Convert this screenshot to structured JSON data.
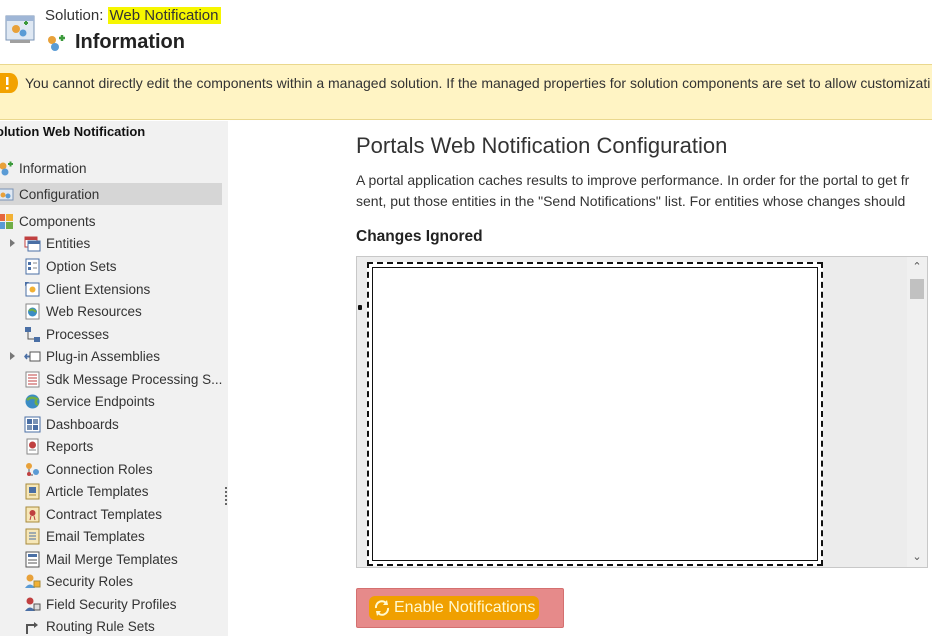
{
  "header": {
    "solution_prefix": "Solution: ",
    "solution_name": "Web Notification",
    "page_title": "Information"
  },
  "warning": {
    "text": "You cannot directly edit the components within a managed solution. If the managed properties for solution components are set to allow customizati"
  },
  "sidebar": {
    "title": "olution Web Notification",
    "items": [
      {
        "label": "Information"
      },
      {
        "label": "Configuration"
      },
      {
        "label": "Components"
      },
      {
        "label": "Entities"
      },
      {
        "label": "Option Sets"
      },
      {
        "label": "Client Extensions"
      },
      {
        "label": "Web Resources"
      },
      {
        "label": "Processes"
      },
      {
        "label": "Plug-in Assemblies"
      },
      {
        "label": "Sdk Message Processing S..."
      },
      {
        "label": "Service Endpoints"
      },
      {
        "label": "Dashboards"
      },
      {
        "label": "Reports"
      },
      {
        "label": "Connection Roles"
      },
      {
        "label": "Article Templates"
      },
      {
        "label": "Contract Templates"
      },
      {
        "label": "Email Templates"
      },
      {
        "label": "Mail Merge Templates"
      },
      {
        "label": "Security Roles"
      },
      {
        "label": "Field Security Profiles"
      },
      {
        "label": "Routing Rule Sets"
      }
    ]
  },
  "main": {
    "title": "Portals Web Notification Configuration",
    "description_line1": "A portal application caches results to improve performance. In order for the portal to get fr",
    "description_line2": "sent, put those entities in the \"Send Notifications\" list. For entities whose changes should",
    "changes_ignored_label": "Changes Ignored",
    "enable_button_label": "Enable Notifications"
  },
  "colors": {
    "highlight_yellow": "#f6f600",
    "warning_bg": "#fff4c4",
    "button_bg": "#e68a8a",
    "button_highlight": "#f0a000"
  }
}
